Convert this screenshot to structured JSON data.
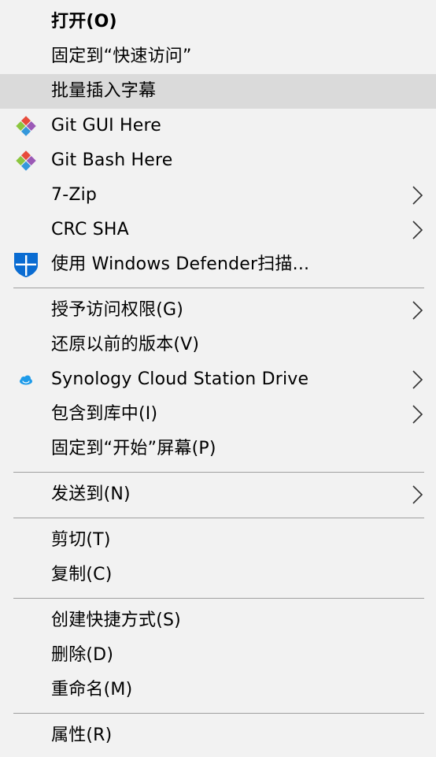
{
  "menu": {
    "items": [
      {
        "label": "打开(O)",
        "bold": true
      },
      {
        "label": "固定到“快速访问”"
      },
      {
        "label": "批量插入字幕",
        "highlighted": true
      },
      {
        "label": "Git GUI Here",
        "icon": "git-icon"
      },
      {
        "label": "Git Bash Here",
        "icon": "git-icon"
      },
      {
        "label": "7-Zip",
        "submenu": true
      },
      {
        "label": "CRC SHA",
        "submenu": true
      },
      {
        "label": "使用 Windows Defender扫描...",
        "icon": "shield-icon"
      },
      {
        "label": "授予访问权限(G)",
        "submenu": true
      },
      {
        "label": "还原以前的版本(V)"
      },
      {
        "label": "Synology Cloud Station Drive",
        "icon": "cloud-icon",
        "submenu": true
      },
      {
        "label": "包含到库中(I)",
        "submenu": true
      },
      {
        "label": "固定到“开始”屏幕(P)"
      },
      {
        "label": "发送到(N)",
        "submenu": true
      },
      {
        "label": "剪切(T)"
      },
      {
        "label": "复制(C)"
      },
      {
        "label": "创建快捷方式(S)"
      },
      {
        "label": "删除(D)"
      },
      {
        "label": "重命名(M)"
      },
      {
        "label": "属性(R)"
      }
    ]
  },
  "colors": {
    "background": "#f2f2f2",
    "highlight": "#dadada",
    "separator": "#a0a0a0",
    "shield": "#0a6cd2"
  }
}
